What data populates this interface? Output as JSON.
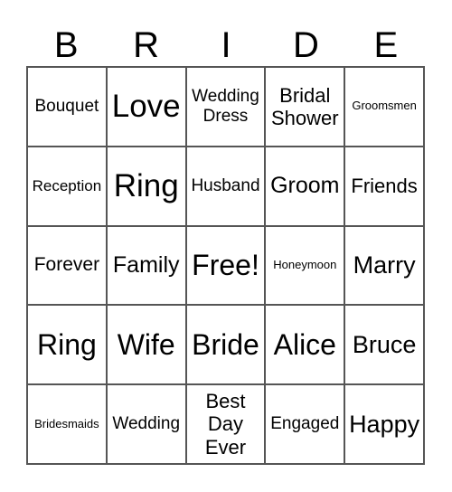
{
  "header": [
    "B",
    "R",
    "I",
    "D",
    "E"
  ],
  "cells": [
    [
      "Bouquet",
      "Love",
      "Wedding Dress",
      "Bridal Shower",
      "Groomsmen"
    ],
    [
      "Reception",
      "Ring",
      "Husband",
      "Groom",
      "Friends"
    ],
    [
      "Forever",
      "Family",
      "Free!",
      "Honeymoon",
      "Marry"
    ],
    [
      "Ring",
      "Wife",
      "Bride",
      "Alice",
      "Bruce"
    ],
    [
      "Bridesmaids",
      "Wedding",
      "Best Day Ever",
      "Engaged",
      "Happy"
    ]
  ]
}
